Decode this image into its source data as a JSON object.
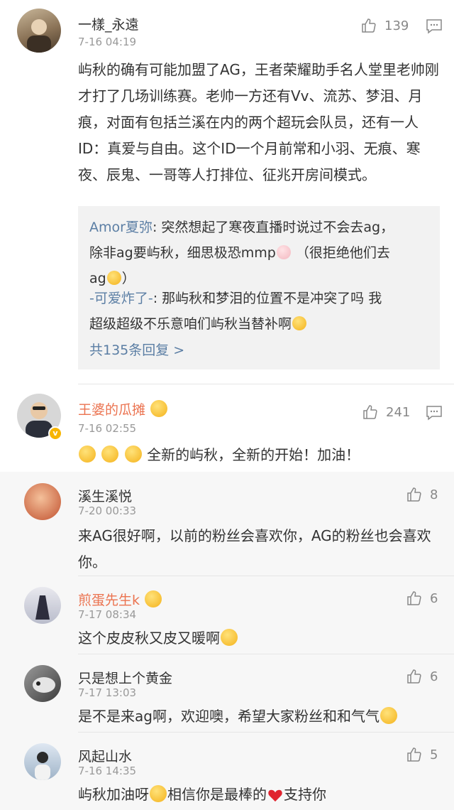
{
  "comments": [
    {
      "user": "一樣_永遠",
      "time": "7-16 04:19",
      "likes": "139",
      "text": "屿秋的确有可能加盟了AG，王者荣耀助手名人堂里老帅刚才打了几场训练赛。老帅一方还有Vv、流苏、梦泪、月痕，对面有包括兰溪在内的两个超玩会队员，还有一人ID：真爱与自由。这个ID一个月前常和小羽、无痕、寒夜、辰鬼、一哥等人打排位、征兆开房间模式。",
      "replies": [
        {
          "user": "Amor夏弥",
          "text_a": ": 突然想起了寒夜直播时说过不会去ag，",
          "text_b": "除非ag要屿秋，细思极恐mmp",
          "text_c": "（很拒绝他们去",
          "text_d": "ag",
          "text_e": "）"
        },
        {
          "user": "-可爱炸了-",
          "text_a": ": 那屿秋和梦泪的位置不是冲突了吗 我",
          "text_b": "超级超级不乐意咱们屿秋当替补啊"
        }
      ],
      "reply_total": "共135条回复 >"
    },
    {
      "user": "王婆的瓜摊",
      "time": "7-16 02:55",
      "likes": "241",
      "text": "全新的屿秋，全新的开始！加油！",
      "verified_mark": "v"
    }
  ],
  "sub_comments": [
    {
      "user": "溪生溪悦",
      "time": "7-20 00:33",
      "likes": "8",
      "text": "来AG很好啊，以前的粉丝会喜欢你，AG的粉丝也会喜欢你。"
    },
    {
      "user": "煎蛋先生k",
      "time": "7-17 08:34",
      "likes": "6",
      "text": "这个皮皮秋又皮又暖啊"
    },
    {
      "user": "只是想上个黄金",
      "time": "7-17 13:03",
      "likes": "6",
      "text": "是不是来ag啊，欢迎噢，希望大家粉丝和和气气"
    },
    {
      "user": "风起山水",
      "time": "7-16 14:35",
      "likes": "5",
      "text_a": "屿秋加油呀",
      "text_b": "相信你是最棒的",
      "text_c": "支持你"
    }
  ],
  "colors": {
    "accent_orange": "#eb7350",
    "link_blue": "#5b7ea4",
    "meta_gray": "#999999"
  },
  "icons": [
    "thumbs-up-icon",
    "comment-icon",
    "emoji-icon",
    "heart-icon",
    "verified-badge-icon"
  ]
}
